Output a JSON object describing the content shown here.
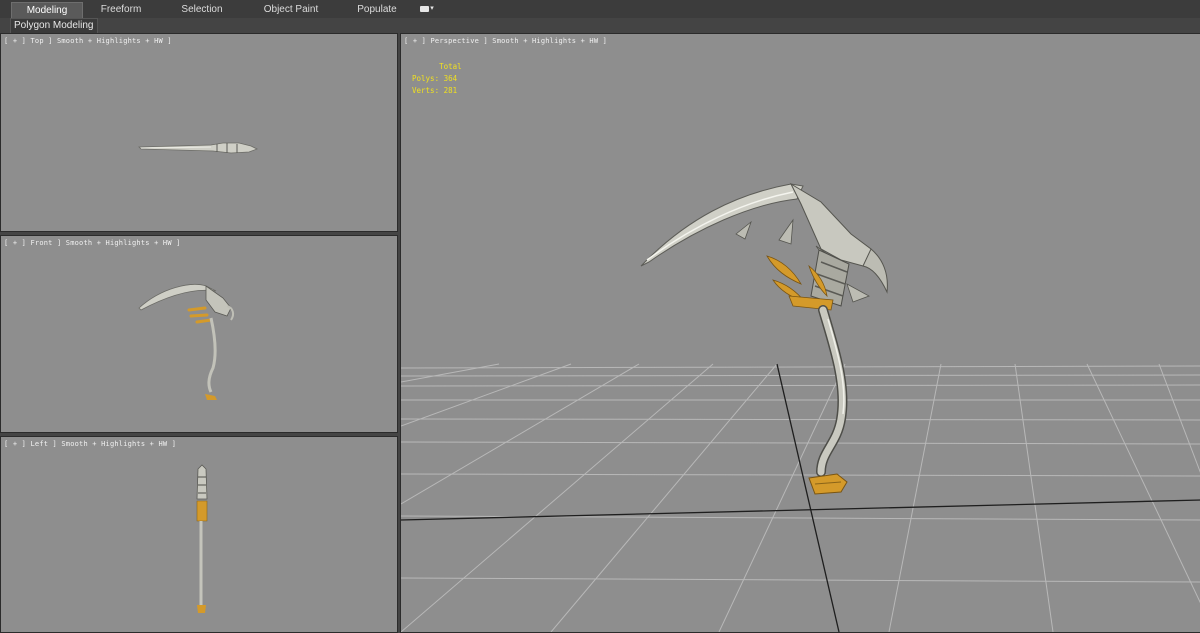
{
  "ribbon": {
    "tabs": [
      {
        "label": "Modeling",
        "active": true
      },
      {
        "label": "Freeform",
        "active": false
      },
      {
        "label": "Selection",
        "active": false
      },
      {
        "label": "Object Paint",
        "active": false
      },
      {
        "label": "Populate",
        "active": false
      }
    ],
    "options_icon": "ribbon-options-icon"
  },
  "subbar": {
    "label": "Polygon Modeling"
  },
  "viewports": {
    "top": {
      "label": "[ + ] Top ] Smooth + Highlights + HW ]"
    },
    "front": {
      "label": "[ + ] Front ] Smooth + Highlights + HW ]"
    },
    "left": {
      "label": "[ + ] Left ] Smooth + Highlights + HW ]"
    },
    "perspective": {
      "label": "[ + ] Perspective ] Smooth + Highlights + HW ]",
      "stats": {
        "header": "Total",
        "polys_label": "Polys:",
        "polys_value": "364",
        "verts_label": "Verts:",
        "verts_value": "281"
      }
    }
  },
  "colors": {
    "viewport_bg": "#8e8e8e",
    "stats_text": "#f0e020",
    "grid_line": "#b8b8b8",
    "grid_axis": "#1e1e1e",
    "blade": "#c9c9bf",
    "gold": "#d49a2a"
  }
}
